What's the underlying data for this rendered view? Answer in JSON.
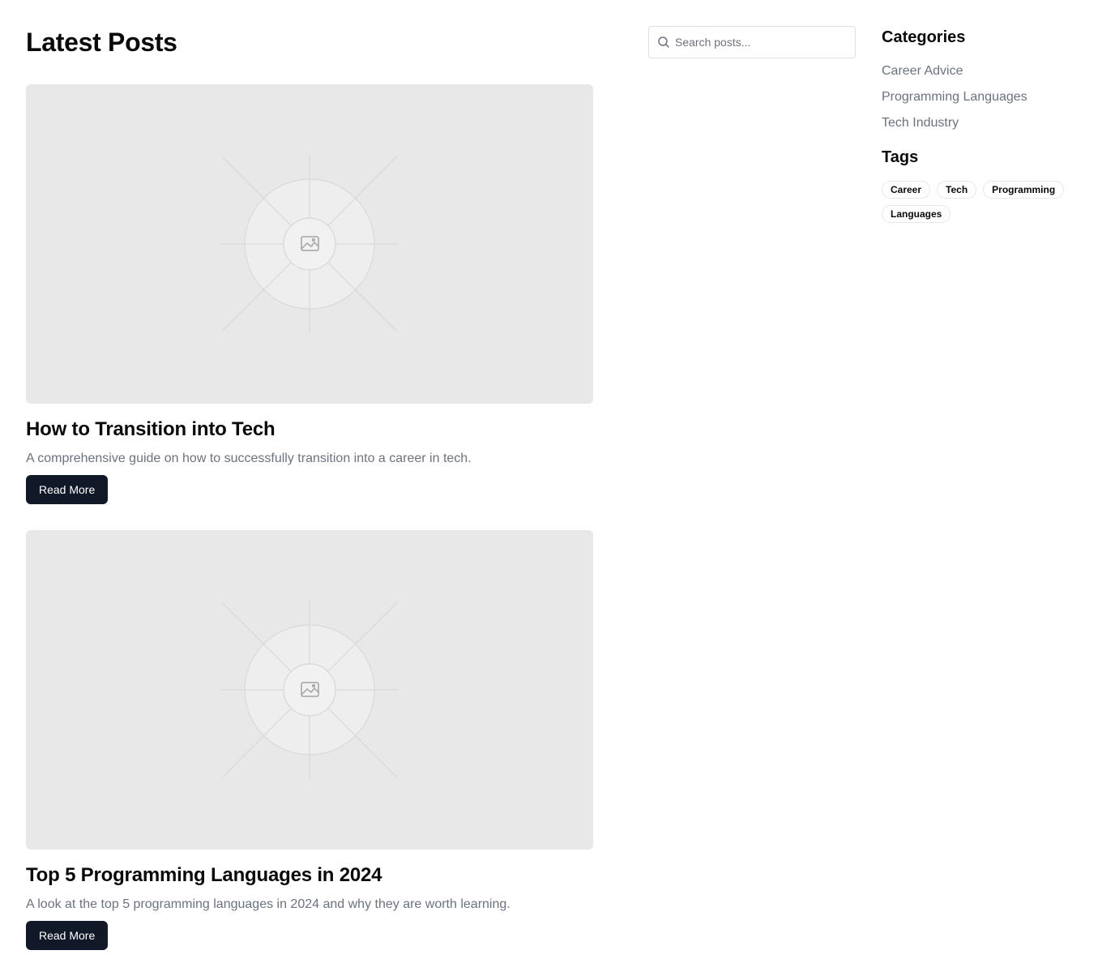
{
  "main": {
    "title": "Latest Posts",
    "posts": [
      {
        "title": "How to Transition into Tech",
        "excerpt": "A comprehensive guide on how to successfully transition into a career in tech.",
        "button_label": "Read More",
        "image_icon": "image-placeholder-icon"
      },
      {
        "title": "Top 5 Programming Languages in 2024",
        "excerpt": "A look at the top 5 programming languages in 2024 and why they are worth learning.",
        "button_label": "Read More",
        "image_icon": "image-placeholder-icon"
      }
    ]
  },
  "search": {
    "placeholder": "Search posts...",
    "value": "",
    "icon": "search-icon"
  },
  "sidebar": {
    "categories_heading": "Categories",
    "categories": [
      "Career Advice",
      "Programming Languages",
      "Tech Industry"
    ],
    "tags_heading": "Tags",
    "tags": [
      "Career",
      "Tech",
      "Programming",
      "Languages"
    ]
  },
  "colors": {
    "button_bg": "#111827",
    "muted_text": "#6b7280",
    "placeholder_bg": "#e8e8e8"
  }
}
